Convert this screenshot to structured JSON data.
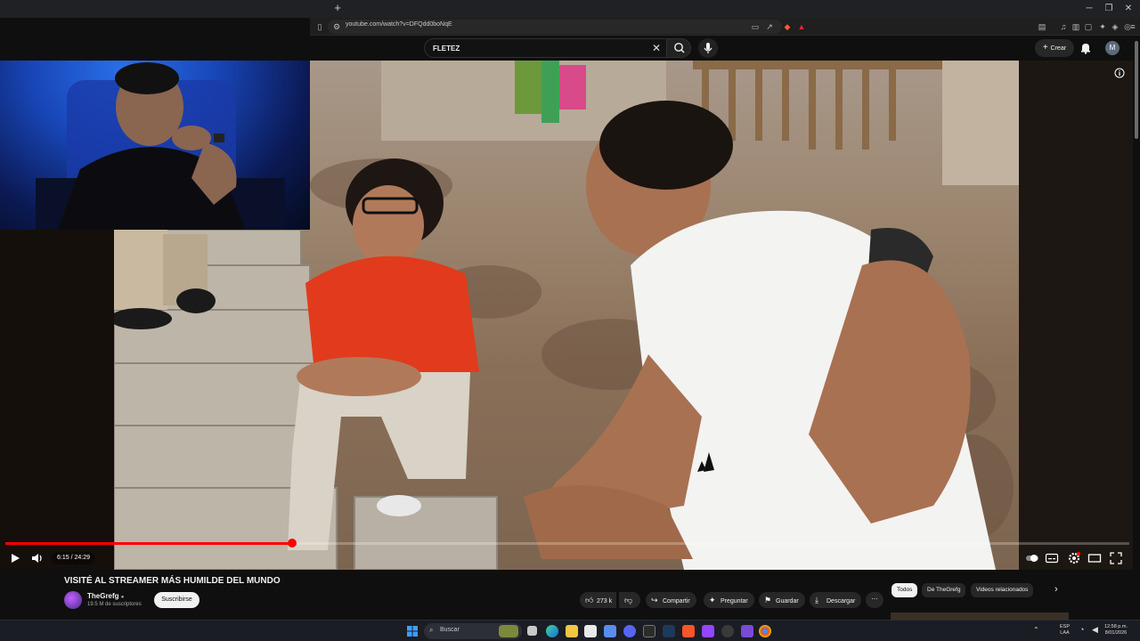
{
  "browser": {
    "url": "youtube.com/watch?v=DFQdd0boNqE"
  },
  "youtube": {
    "search_query": "FLETEZ",
    "create_label": "Crear",
    "avatar_letter": "M"
  },
  "player": {
    "time_display": "6:15 / 24:29",
    "progress": 0.2553
  },
  "video": {
    "title": "VISITÉ AL STREAMER MÁS HUMILDE DEL MUNDO",
    "channel_name": "TheGrefg",
    "subscribers": "19.5 M de suscriptores",
    "subscribe_label": "Suscribirse",
    "likes": "273 k",
    "actions": {
      "share": "Compartir",
      "ask": "Preguntar",
      "save": "Guardar",
      "download": "Descargar"
    }
  },
  "related_chips": [
    "Todos",
    "De TheGrefg",
    "Videos relacionados"
  ],
  "taskbar": {
    "search_label": "Buscar",
    "lang_top": "ESP",
    "lang_bottom": "LAA",
    "time": "12:58 p.m.",
    "date": "8/01/2026"
  },
  "colors": {
    "accent_red": "#ff0000",
    "background": "#0f0f0f",
    "pill_bg": "#272727"
  }
}
